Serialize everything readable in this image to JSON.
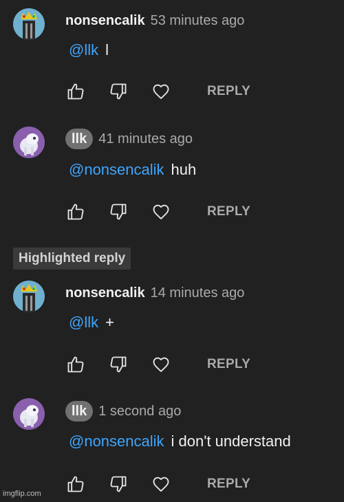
{
  "comments": [
    {
      "author": "nonsencalik",
      "time": "53 minutes ago",
      "mention": "@llk",
      "text": "l",
      "reply_label": "REPLY",
      "avatar": "yellow-crown-avatar",
      "author_style": "plain"
    },
    {
      "author": "llk",
      "time": "41 minutes ago",
      "mention": "@nonsencalik",
      "text": "huh",
      "reply_label": "REPLY",
      "avatar": "purple-creature-avatar",
      "author_style": "chip"
    },
    {
      "author": "nonsencalik",
      "time": "14 minutes ago",
      "mention": "@llk",
      "text": "+",
      "reply_label": "REPLY",
      "avatar": "yellow-crown-avatar",
      "author_style": "plain"
    },
    {
      "author": "llk",
      "time": "1 second ago",
      "mention": "@nonsencalik",
      "text": "i don't understand",
      "reply_label": "REPLY",
      "avatar": "purple-creature-avatar",
      "author_style": "chip"
    }
  ],
  "highlighted_reply_label": "Highlighted reply",
  "watermark": "imgflip.com",
  "colors": {
    "background": "#212121",
    "mention": "#3ea6ff",
    "muted": "#aaaaaa",
    "chip": "#717171"
  }
}
